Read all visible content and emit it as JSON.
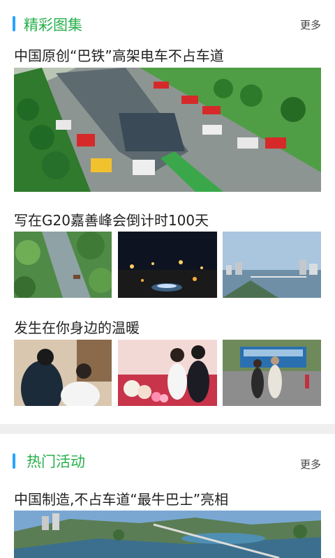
{
  "gallery": {
    "title": "精彩图集",
    "more": "更多",
    "items": [
      {
        "title": "中国原创“巴铁”高架电车不占车道"
      },
      {
        "title": "写在G20嘉善峰会倒计时100天"
      },
      {
        "title": "发生在你身边的温暖"
      }
    ]
  },
  "activities": {
    "title": "热门活动",
    "more": "更多",
    "items": [
      {
        "title": "中国制造,不占车道“最牛巴士”亮相"
      }
    ]
  },
  "colors": {
    "accent_bar": "#27a4ff",
    "section_title": "#26b04a"
  }
}
